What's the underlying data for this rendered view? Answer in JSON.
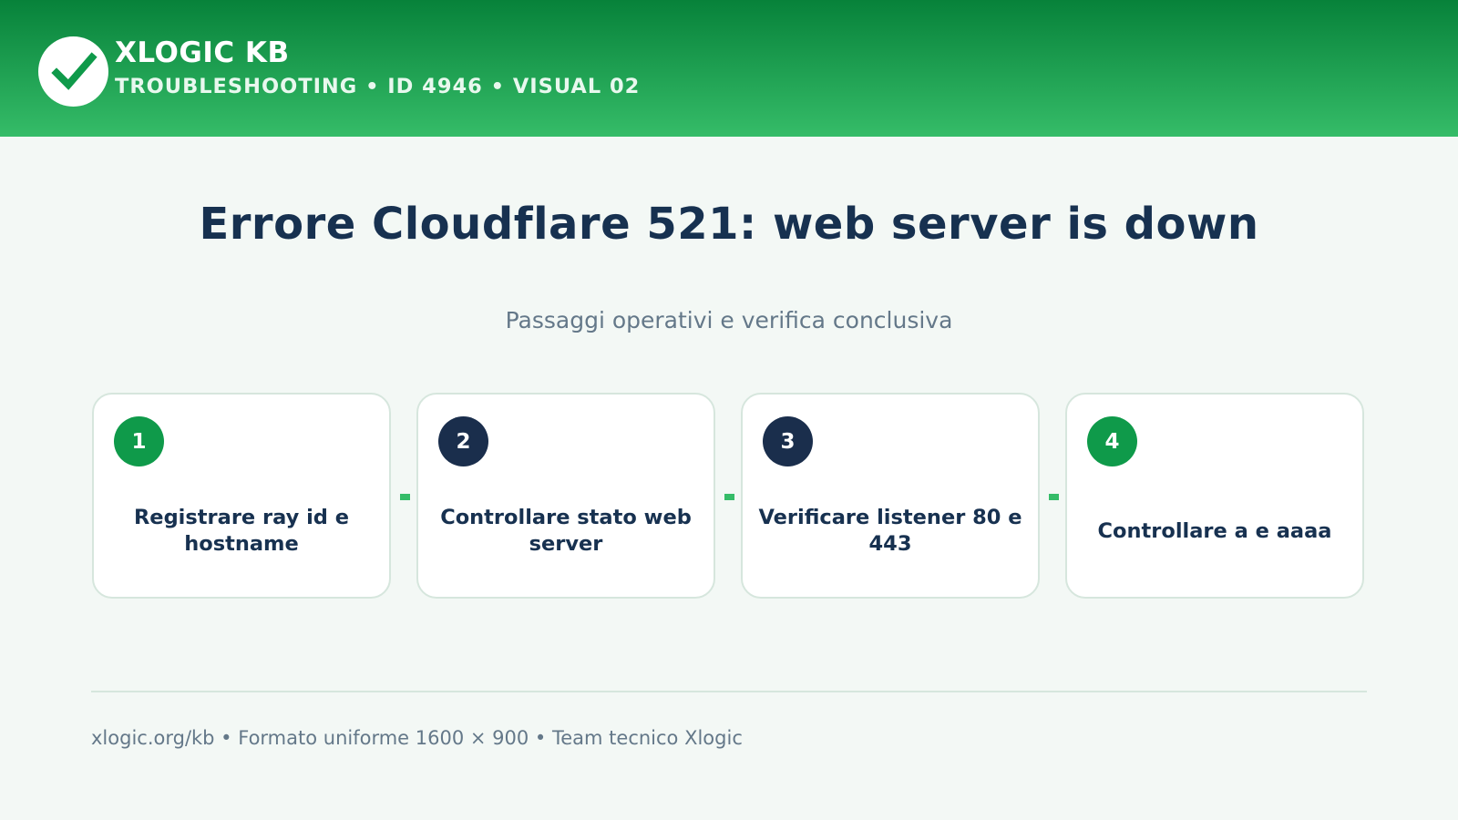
{
  "header": {
    "brand": "XLOGIC KB",
    "subtitle": "TROUBLESHOOTING • ID 4946 • VISUAL 02",
    "logo_icon": "check-icon"
  },
  "title": "Errore Cloudflare 521: web server is down",
  "subtitle": "Passaggi operativi e verifica conclusiva",
  "steps": [
    {
      "number": "1",
      "label": "Registrare ray id e hostname",
      "badge_color": "#0f9a4a"
    },
    {
      "number": "2",
      "label": "Controllare stato web server",
      "badge_color": "#1a2e4c"
    },
    {
      "number": "3",
      "label": "Verificare listener 80 e 443",
      "badge_color": "#1a2e4c"
    },
    {
      "number": "4",
      "label": "Controllare a e aaaa",
      "badge_color": "#0f9a4a"
    }
  ],
  "footer": "xlogic.org/kb • Formato uniforme 1600 × 900 • Team tecnico Xlogic",
  "colors": {
    "brand_green": "#0f9a4a",
    "navy": "#173150",
    "accent_green": "#35bc68",
    "muted_text": "#647889"
  }
}
